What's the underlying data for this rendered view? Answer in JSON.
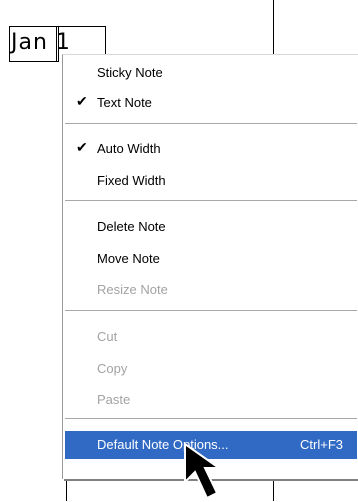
{
  "calendar": {
    "cell_text": "Jan 1"
  },
  "menu": {
    "items": [
      {
        "label": "Sticky Note",
        "checked": false,
        "enabled": true
      },
      {
        "label": "Text Note",
        "checked": true,
        "enabled": true
      },
      {
        "label": "Auto Width",
        "checked": true,
        "enabled": true
      },
      {
        "label": "Fixed Width",
        "checked": false,
        "enabled": true
      },
      {
        "label": "Delete Note",
        "checked": false,
        "enabled": true
      },
      {
        "label": "Move Note",
        "checked": false,
        "enabled": true
      },
      {
        "label": "Resize Note",
        "checked": false,
        "enabled": false
      },
      {
        "label": "Cut",
        "checked": false,
        "enabled": false
      },
      {
        "label": "Copy",
        "checked": false,
        "enabled": false
      },
      {
        "label": "Paste",
        "checked": false,
        "enabled": false
      },
      {
        "label": "Default Note Options...",
        "shortcut": "Ctrl+F3",
        "checked": false,
        "enabled": true,
        "highlighted": true
      }
    ],
    "check_glyph": "✔"
  },
  "colors": {
    "highlight": "#316ac5",
    "disabled_text": "#a3a3a3"
  },
  "icons": {
    "pointer": "mouse-pointer-icon"
  }
}
